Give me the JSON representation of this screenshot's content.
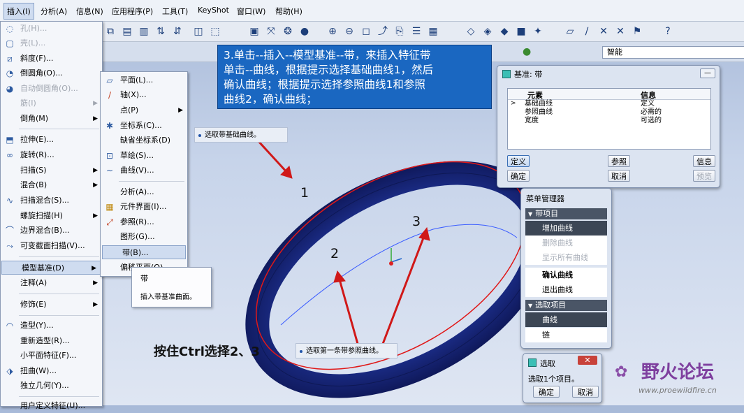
{
  "menubar": {
    "items": [
      "插入(I)",
      "分析(A)",
      "信息(N)",
      "应用程序(P)",
      "工具(T)",
      "KeyShot",
      "窗口(W)",
      "帮助(H)"
    ]
  },
  "status": {
    "filter": "智能"
  },
  "insert_menu": {
    "items": [
      {
        "label": "孔(H)...",
        "icon": "hole-icon",
        "disabled": true
      },
      {
        "label": "壳(L)...",
        "icon": "shell-icon",
        "disabled": true
      },
      {
        "label": "斜度(F)...",
        "icon": "draft-icon"
      },
      {
        "label": "倒圆角(O)...",
        "icon": "round-icon"
      },
      {
        "label": "自动倒圆角(O)...",
        "icon": "auto-round-icon",
        "disabled": true
      },
      {
        "label": "筋(I)",
        "icon": "",
        "disabled": true,
        "submenu": true
      },
      {
        "label": "倒角(M)",
        "icon": "",
        "submenu": true
      },
      {
        "label": "拉伸(E)...",
        "icon": "extrude-icon"
      },
      {
        "label": "旋转(R)...",
        "icon": "revolve-icon"
      },
      {
        "label": "扫描(S)",
        "icon": "",
        "submenu": true
      },
      {
        "label": "混合(B)",
        "icon": "",
        "submenu": true
      },
      {
        "label": "扫描混合(S)...",
        "icon": "swept-blend-icon"
      },
      {
        "label": "螺旋扫描(H)",
        "icon": "",
        "submenu": true
      },
      {
        "label": "边界混合(B)...",
        "icon": "boundary-blend-icon"
      },
      {
        "label": "可变截面扫描(V)...",
        "icon": "var-sweep-icon"
      },
      {
        "label": "模型基准(D)",
        "icon": "",
        "submenu": true,
        "highlight": true
      },
      {
        "label": "注释(A)",
        "icon": "",
        "submenu": true
      },
      {
        "label": "修饰(E)",
        "icon": "",
        "submenu": true
      },
      {
        "label": "造型(Y)...",
        "icon": "style-icon"
      },
      {
        "label": "重新造型(R)...",
        "icon": ""
      },
      {
        "label": "小平面特征(F)...",
        "icon": ""
      },
      {
        "label": "扭曲(W)...",
        "icon": "warp-icon"
      },
      {
        "label": "独立几何(Y)...",
        "icon": ""
      },
      {
        "label": "用户定义特征(U)...",
        "icon": ""
      }
    ]
  },
  "datum_menu": {
    "items": [
      {
        "label": "平面(L)...",
        "icon": "plane-icon"
      },
      {
        "label": "轴(X)...",
        "icon": "axis-icon"
      },
      {
        "label": "点(P)",
        "icon": "",
        "submenu": true
      },
      {
        "label": "坐标系(C)...",
        "icon": "csys-icon"
      },
      {
        "label": "缺省坐标系(D)",
        "icon": ""
      },
      {
        "label": "草绘(S)...",
        "icon": "sketch-icon"
      },
      {
        "label": "曲线(V)...",
        "icon": "curve-icon"
      },
      {
        "label": "分析(A)...",
        "icon": ""
      },
      {
        "label": "元件界面(I)...",
        "icon": "interface-icon"
      },
      {
        "label": "参照(R)...",
        "icon": "reference-icon"
      },
      {
        "label": "图形(G)...",
        "icon": ""
      },
      {
        "label": "带(B)...",
        "icon": "",
        "highlight": true
      },
      {
        "label": "偏移平面(O)...",
        "icon": ""
      }
    ]
  },
  "tooltip": {
    "title": "带",
    "desc": "插入带基准曲面。"
  },
  "instruction": {
    "lines": [
      "3.单击--插入--模型基准--带，来插入特征带",
      "单击--曲线，根据提示选择基础曲线1，然后",
      "确认曲线；根据提示选择参照曲线1和参照",
      "曲线2，确认曲线；"
    ]
  },
  "prompt_top": "选取带基础曲线。",
  "prompt_bottom": "选取第一条带参照曲线。",
  "callouts": {
    "n1": "1",
    "n2": "2",
    "n3": "3",
    "ctrl_text": "按住Ctrl选择2、3"
  },
  "datum_band_dialog": {
    "title": "基准: 带",
    "col_element": "元素",
    "col_info": "信息",
    "rows": [
      {
        "element": "基础曲线",
        "info": "定义"
      },
      {
        "element": "参照曲线",
        "info": "必需的"
      },
      {
        "element": "宽度",
        "info": "可选的"
      }
    ],
    "btn_define": "定义",
    "btn_ref": "参照",
    "btn_info": "信息",
    "btn_ok": "确定",
    "btn_cancel": "取消",
    "btn_preview": "预览"
  },
  "menu_manager": {
    "title": "菜单管理器",
    "section1": "带项目",
    "items1": [
      {
        "label": "增加曲线",
        "state": "selected"
      },
      {
        "label": "删除曲线",
        "state": "disabled"
      },
      {
        "label": "显示所有曲线",
        "state": "disabled"
      },
      {
        "label": "确认曲线",
        "state": "bold"
      },
      {
        "label": "退出曲线",
        "state": "normal"
      }
    ],
    "section2": "选取项目",
    "items2": [
      {
        "label": "曲线",
        "state": "selected"
      },
      {
        "label": "链",
        "state": "normal"
      }
    ]
  },
  "select_dialog": {
    "title": "选取",
    "msg": "选取1个项目。",
    "ok": "确定",
    "cancel": "取消"
  },
  "watermark": {
    "logo": "野火论坛",
    "url": "www.proewildfire.cn"
  },
  "colors": {
    "instruction_bg": "#1a67c1",
    "band": "#1b2c86",
    "arrow": "#d01818"
  }
}
